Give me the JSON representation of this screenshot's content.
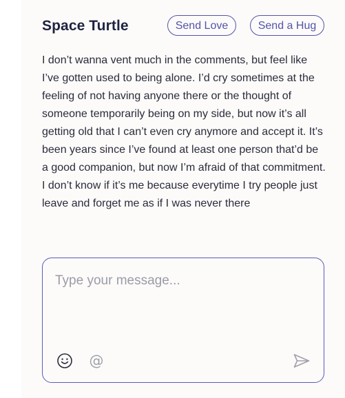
{
  "post": {
    "author": "Space Turtle",
    "actions": {
      "send_love_label": "Send Love",
      "send_hug_label": "Send a Hug"
    },
    "text": "I don’t wanna vent much in the comments, but feel like I’ve gotten used to being alone. I’d cry sometimes at the feeling of not having anyone there or the thought of someone temporarily being on my side, but now it’s all getting old that I can’t even cry anymore and accept it. It’s been years since I’ve found at least one person that’d be a good companion, but now I’m afraid of that commitment. I don’t know if it’s me because everytime I try people just leave and forget me as if I was never there"
  },
  "composer": {
    "placeholder": "Type your message...",
    "value": "",
    "icons": {
      "emoji": "smiley-face-icon",
      "mention": "at-sign-icon",
      "send": "send-paper-plane-icon"
    }
  },
  "colors": {
    "accent": "#5353a8",
    "text": "#2b2b3a",
    "heading": "#1f2340",
    "placeholder": "#9b9ba6",
    "card_bg": "#fcfbfa"
  }
}
